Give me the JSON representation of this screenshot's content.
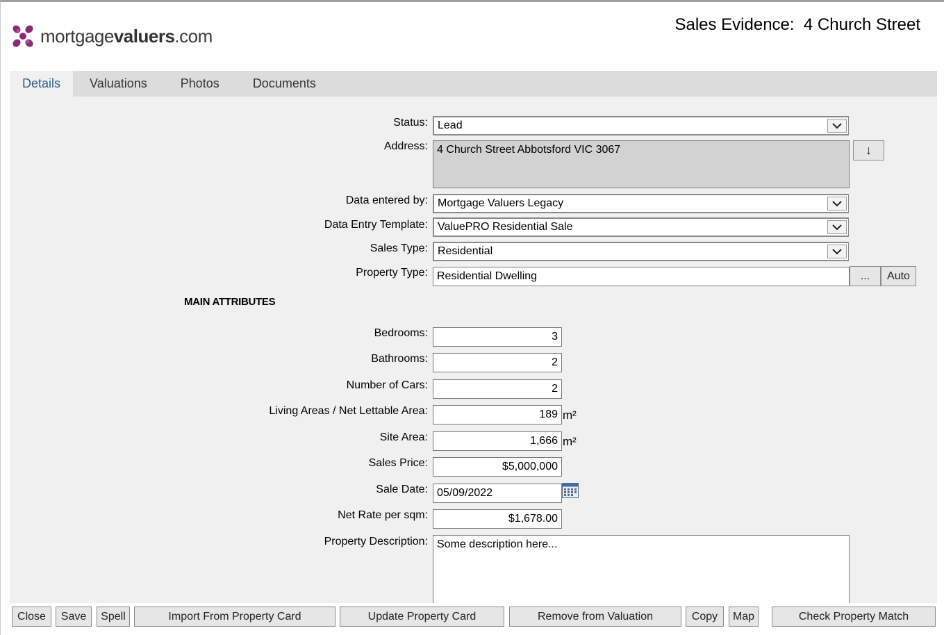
{
  "header": {
    "logo_text_prefix": "mortgage",
    "logo_text_bold": "valuers",
    "logo_text_suffix": ".com",
    "title": "Sales Evidence:  4 Church Street"
  },
  "tabs": [
    {
      "label": "Details",
      "active": true
    },
    {
      "label": "Valuations",
      "active": false
    },
    {
      "label": "Photos",
      "active": false
    },
    {
      "label": "Documents",
      "active": false
    }
  ],
  "form": {
    "status": {
      "label": "Status:",
      "value": "Lead"
    },
    "address": {
      "label": "Address:",
      "value": "4 Church Street Abbotsford VIC 3067",
      "button": "↓"
    },
    "data_entered_by": {
      "label": "Data entered by:",
      "value": "Mortgage Valuers Legacy"
    },
    "data_entry_template": {
      "label": "Data Entry Template:",
      "value": "ValuePRO Residential Sale"
    },
    "sales_type": {
      "label": "Sales Type:",
      "value": "Residential"
    },
    "property_type": {
      "label": "Property Type:",
      "value": "Residential Dwelling",
      "browse_button": "...",
      "auto_button": "Auto"
    },
    "section_title": "MAIN ATTRIBUTES",
    "bedrooms": {
      "label": "Bedrooms:",
      "value": "3"
    },
    "bathrooms": {
      "label": "Bathrooms:",
      "value": "2"
    },
    "cars": {
      "label": "Number of Cars:",
      "value": "2"
    },
    "living_area": {
      "label": "Living Areas / Net Lettable Area:",
      "value": "189",
      "unit": "m²"
    },
    "site_area": {
      "label": "Site Area:",
      "value": "1,666",
      "unit": "m²"
    },
    "sales_price": {
      "label": "Sales Price:",
      "value": "$5,000,000"
    },
    "sale_date": {
      "label": "Sale Date:",
      "value": "05/09/2022"
    },
    "net_rate": {
      "label": "Net Rate per sqm:",
      "value": "$1,678.00"
    },
    "description": {
      "label": "Property Description:",
      "value": "Some description here..."
    }
  },
  "actions": {
    "close": "Close",
    "save": "Save",
    "spell": "Spell",
    "import": "Import From Property Card",
    "update": "Update Property Card",
    "remove": "Remove from Valuation",
    "copy": "Copy",
    "map": "Map",
    "check": "Check Property Match"
  },
  "colors": {
    "brand_purple": "#8b2a7a",
    "active_tab_text": "#2d5d8a",
    "panel_bg": "#f0f0f0",
    "readonly_bg": "#d2d2d2"
  }
}
